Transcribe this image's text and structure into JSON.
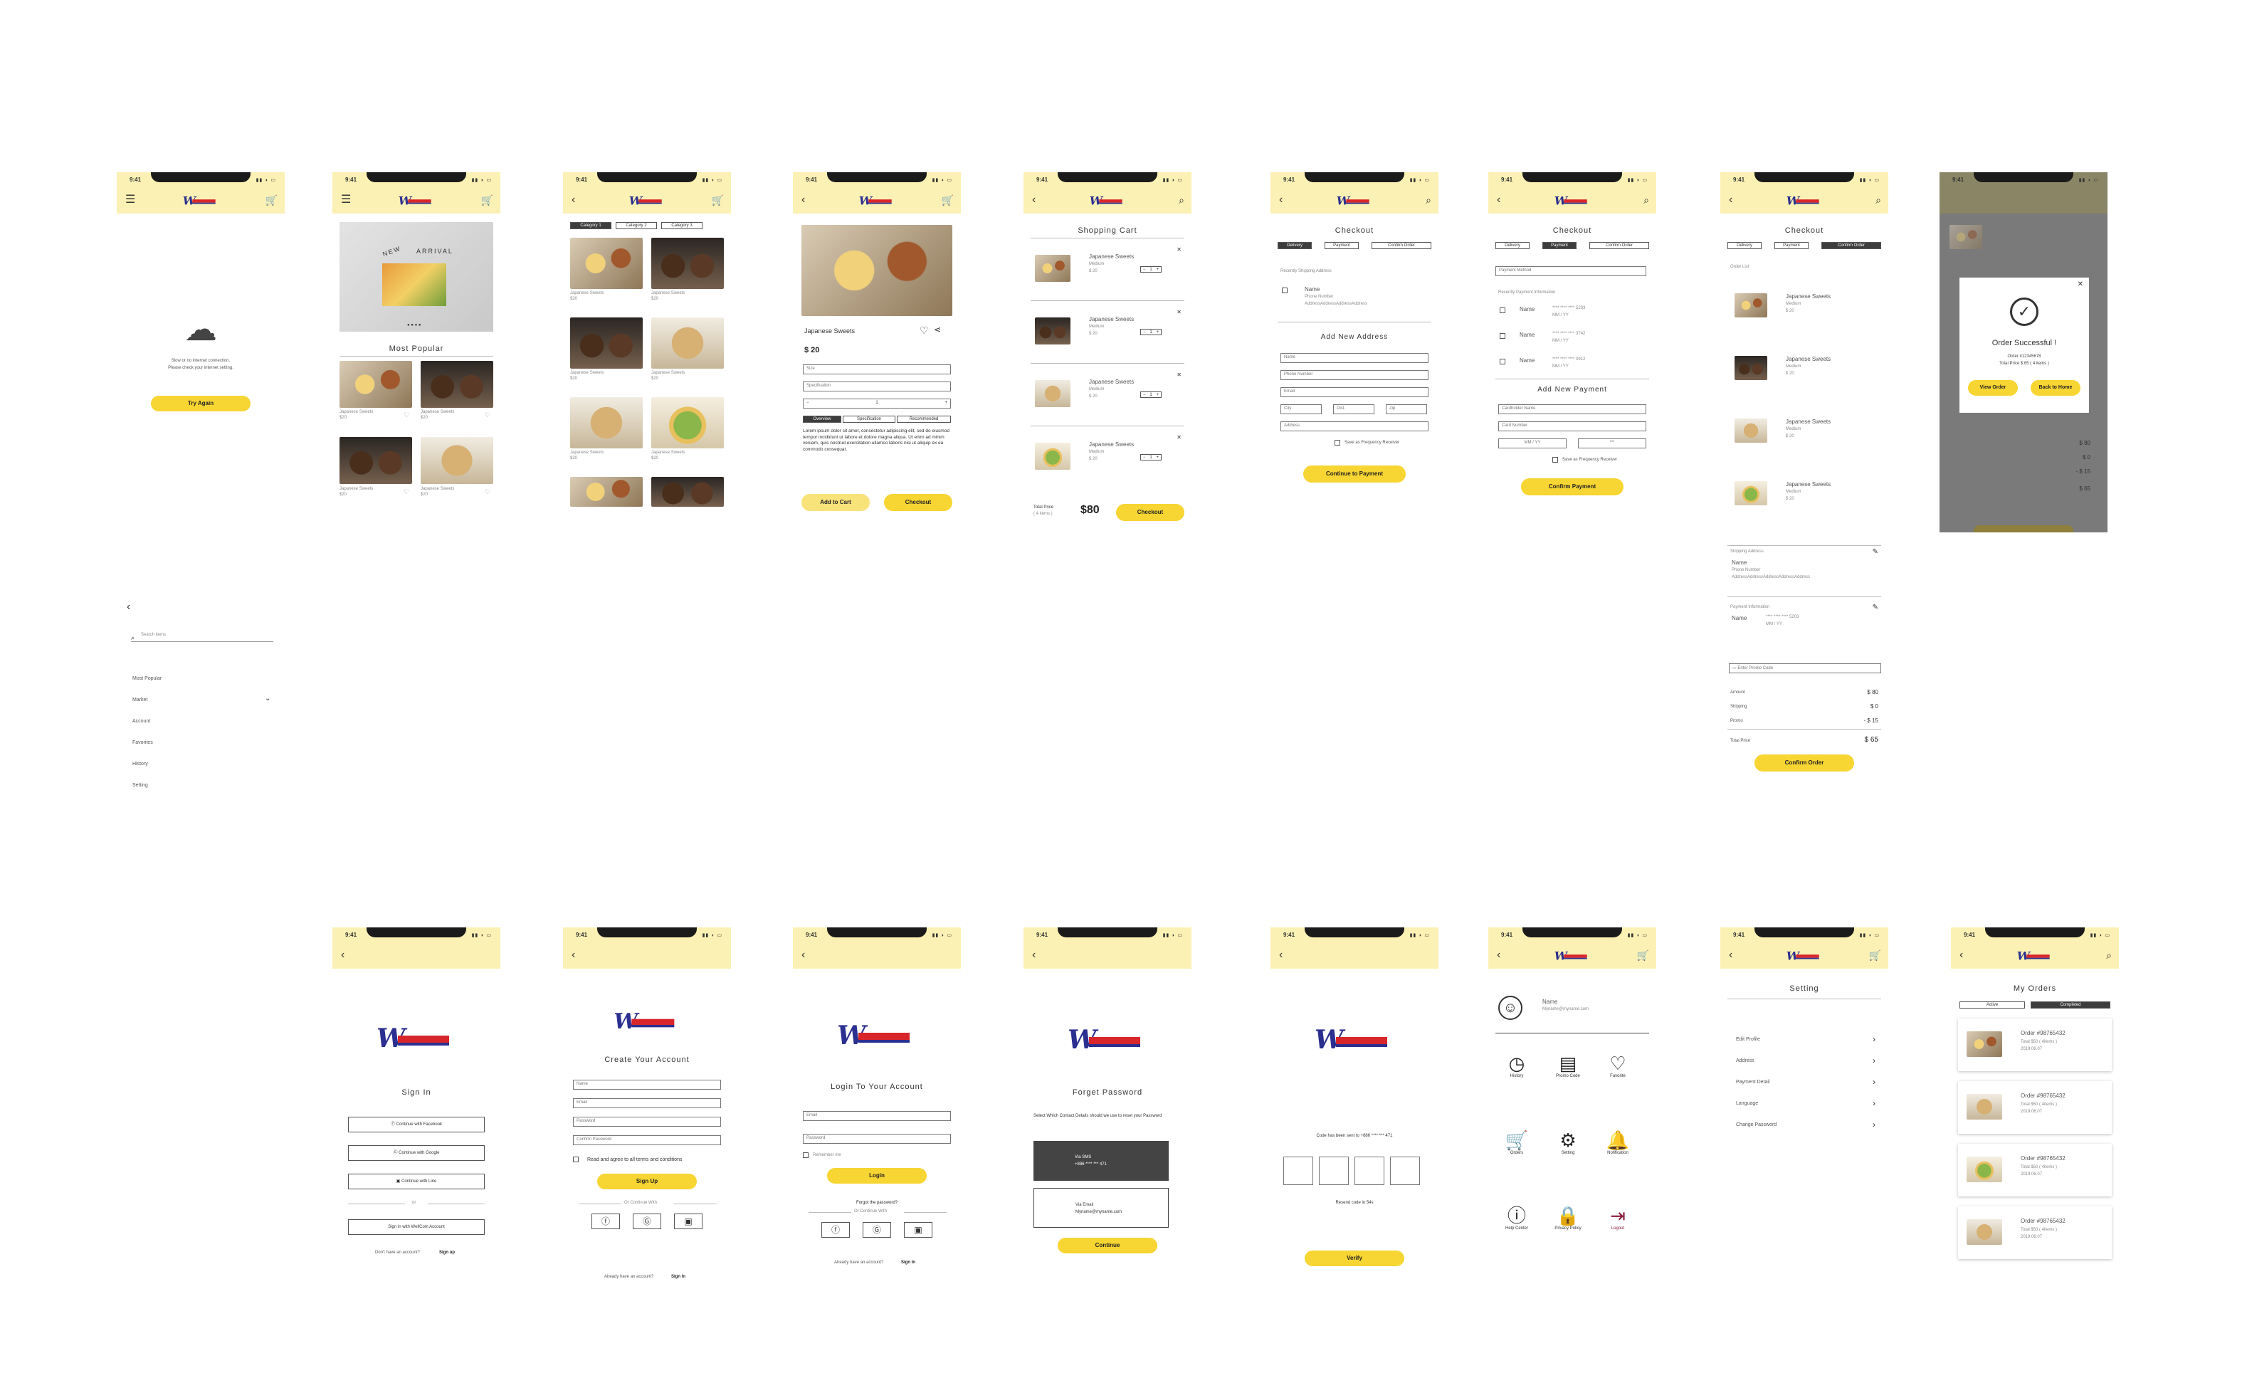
{
  "status": {
    "time": "9:41"
  },
  "offline": {
    "msg1": "Slow or no internet connection.",
    "msg2": "Please check your internet setting.",
    "button": "Try Again"
  },
  "home": {
    "banner_new": "NEW",
    "banner_arrival": "ARRIVAL",
    "section": "Most Popular",
    "items": [
      {
        "name": "Japanese Sweets",
        "price": "$20"
      },
      {
        "name": "Japanese Sweets",
        "price": "$20"
      },
      {
        "name": "Japanese Sweets",
        "price": "$20"
      },
      {
        "name": "Japanese Sweets",
        "price": "$20"
      }
    ]
  },
  "category": {
    "tabs": [
      "Category 1",
      "Category 2",
      "Category 3"
    ],
    "item": "Japanese Sweets",
    "price": "$20"
  },
  "product": {
    "name": "Japanese Sweets",
    "price": "$ 20",
    "size": "Size",
    "spec": "Specification",
    "qty": "1",
    "tabs": [
      "Overview",
      "Specification",
      "Recommended"
    ],
    "desc": "Lorem ipsum dolor sit amet, consectetur adipiscing elit, sed do eiusmod tempor incididunt ut labore et dolore magna aliqua. Ut enim ad minim veniam, quis nostrud exercitation ullamco laboris nisi ut aliquip ex ea commodo consequat.",
    "add": "Add to Cart",
    "checkout": "Checkout"
  },
  "cart": {
    "title": "Shopping Cart",
    "item": "Japanese Sweets",
    "size": "Medium",
    "price": "$ 20",
    "qty": "1",
    "total_label": "Total Price",
    "total_items": "( 4 items )",
    "total": "$80",
    "checkout": "Checkout"
  },
  "checkout1": {
    "title": "Checkout",
    "tabs": [
      "Delivery",
      "Payment",
      "Confirm Order"
    ],
    "recent": "Recently Shipping Address",
    "name": "Name",
    "phone": "Phone Number",
    "address": "AddressAddressAddressAddress",
    "add_new": "Add New Address",
    "fields": [
      "Name",
      "Phone Number",
      "Email"
    ],
    "city": "City",
    "dist": "Dist.",
    "zip": "Zip",
    "addr": "Address",
    "save": "Save as Frequency Receiver",
    "button": "Continue to Payment"
  },
  "checkout2": {
    "title": "Checkout",
    "method": "Payment Method",
    "recent": "Recently Payment Information",
    "cards": [
      {
        "name": "Name",
        "num": "**** **** **** 5203",
        "exp": "MM / YY"
      },
      {
        "name": "Name",
        "num": "**** **** **** 3742",
        "exp": "MM / YY"
      },
      {
        "name": "Name",
        "num": "**** **** **** 0912",
        "exp": "MM / YY"
      }
    ],
    "add_new": "Add New Payment",
    "f1": "Cardholder Name",
    "f2": "Card Number",
    "f3": "MM / YY",
    "f4": "***",
    "save": "Save as Frequency Receiver",
    "button": "Confirm Payment"
  },
  "checkout3": {
    "title": "Checkout",
    "order_list": "Order List",
    "item": "Japanese Sweets",
    "size": "Medium",
    "price": "$ 20",
    "qty": "1",
    "ship_label": "Shipping Address",
    "name": "Name",
    "phone": "Phone Number",
    "address": "AddressAddressAddressAddressAddress",
    "pay_label": "Payment Information",
    "card": "**** **** **** 5203",
    "exp": "MM / YY",
    "promo": "Enter Promo Code",
    "rows": [
      {
        "k": "Amount",
        "v": "$ 80"
      },
      {
        "k": "Shipping",
        "v": "$ 0"
      },
      {
        "k": "Promo",
        "v": "- $ 15"
      }
    ],
    "total_k": "Total Price",
    "total_v": "$ 65",
    "button": "Confirm Order"
  },
  "success": {
    "title": "Order Successful !",
    "order": "Order #12345678",
    "total": "Total Price $ 65 ( 4 items )",
    "view": "View Order",
    "home": "Back to Home",
    "bg_prices": [
      "$ 80",
      "$ 0",
      "- $ 15",
      "$ 65"
    ]
  },
  "menu": {
    "search": "Search items",
    "items": [
      "Most Popular",
      "Market",
      "Account",
      "Favorites",
      "History",
      "Setting"
    ]
  },
  "signin": {
    "title": "Sign In",
    "fb": "Continue with Facebook",
    "google": "Continue with Google",
    "line": "Continue with Line",
    "or": "or",
    "own": "Sign in with WellCom Account",
    "no_acc": "Don't have an account?",
    "signup": "Sign up"
  },
  "create": {
    "title": "Create Your Account",
    "fields": [
      "Name",
      "Email",
      "Password",
      "Confirm Password"
    ],
    "agree": "Read and agree to all terms and conditions",
    "button": "Sign Up",
    "or": "Or Continue With",
    "have": "Already have an account?",
    "signin": "Sign In"
  },
  "login": {
    "title": "Login To Your Account",
    "email": "Email",
    "password": "Password",
    "remember": "Remember me",
    "button": "Login",
    "forgot": "Forgot the password?",
    "or": "Or Continue With",
    "have": "Already have an account?",
    "signin": "Sign In"
  },
  "forgot": {
    "title": "Forget Password",
    "desc": "Select Which Contact Details should we use to reset your Password",
    "sms_label": "Via SMS",
    "sms": "+886 **** *** 471",
    "email_label": "Via Email",
    "email": "Myname@myname.com",
    "button": "Continue"
  },
  "verify": {
    "msg": "Code has been sent to +886 **** *** 471",
    "resend": "Resend code in 54s",
    "button": "Verify"
  },
  "account": {
    "name": "Name",
    "email": "Myname@myname.com",
    "grid": [
      "History",
      "Promo Code",
      "Favorite",
      "Orders",
      "Setting",
      "Notification",
      "Help Center",
      "Privacy Policy",
      "Logout"
    ]
  },
  "setting": {
    "title": "Setting",
    "items": [
      "Edit Profile",
      "Address",
      "Payment Detail",
      "Language",
      "Change Password"
    ]
  },
  "orders": {
    "title": "My Orders",
    "tabs": [
      "Active",
      "Completed"
    ],
    "order": "Order #98765432",
    "total": "Total $50 ( 4items )",
    "date": "2019.06.07"
  },
  "colors": {
    "header": "#fbf1b4",
    "accent": "#f7d532",
    "dark": "#3d3d3d",
    "logout": "#8b1a3a",
    "logo": "#2b2f8f"
  }
}
